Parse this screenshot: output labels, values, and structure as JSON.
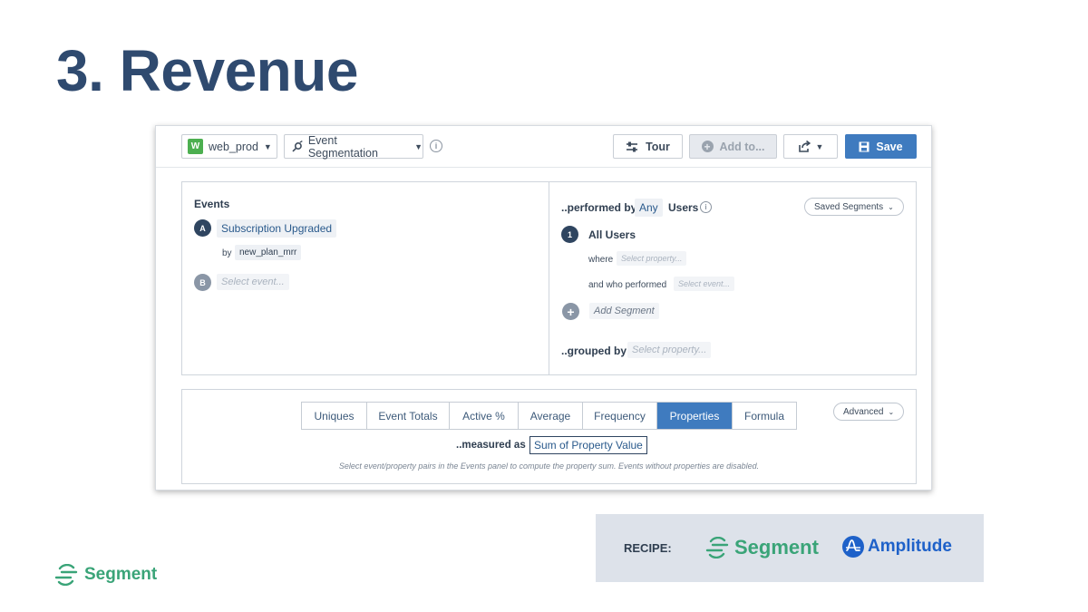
{
  "slide": {
    "title": "3. Revenue"
  },
  "toolbar": {
    "project_badge": "W",
    "project": "web_prod",
    "chart_type": "Event Segmentation",
    "tour": "Tour",
    "add_to": "Add to...",
    "save": "Save"
  },
  "events": {
    "heading": "Events",
    "items": [
      {
        "letter": "A",
        "name": "Subscription Upgraded",
        "by_label": "by",
        "by_property": "new_plan_mrr"
      },
      {
        "letter": "B",
        "placeholder": "Select event..."
      }
    ]
  },
  "segments": {
    "performed_by_label": "..performed by",
    "any": "Any",
    "users": "Users",
    "saved_segments": "Saved Segments",
    "segment_number": "1",
    "segment_name": "All Users",
    "where_label": "where",
    "where_placeholder": "Select property...",
    "who_performed_label": "and who performed",
    "who_performed_placeholder": "Select event...",
    "add_segment": "Add Segment",
    "grouped_by_label": "..grouped by",
    "grouped_by_placeholder": "Select property..."
  },
  "measure": {
    "tabs": [
      "Uniques",
      "Event Totals",
      "Active %",
      "Average",
      "Frequency",
      "Properties",
      "Formula"
    ],
    "active_tab": "Properties",
    "advanced": "Advanced",
    "measured_as_label": "..measured as",
    "measured_as_value": "Sum of Property Value",
    "hint": "Select event/property pairs in the Events panel to compute the property sum. Events without properties are disabled."
  },
  "footer": {
    "brand": "Segment"
  },
  "recipe": {
    "label": "RECIPE:",
    "partner1": "Segment",
    "partner2": "Amplitude"
  },
  "colors": {
    "title": "#2f4a6f",
    "save": "#3f7bbf",
    "segment_green": "#3aa478",
    "amplitude_blue": "#1e61c9"
  }
}
